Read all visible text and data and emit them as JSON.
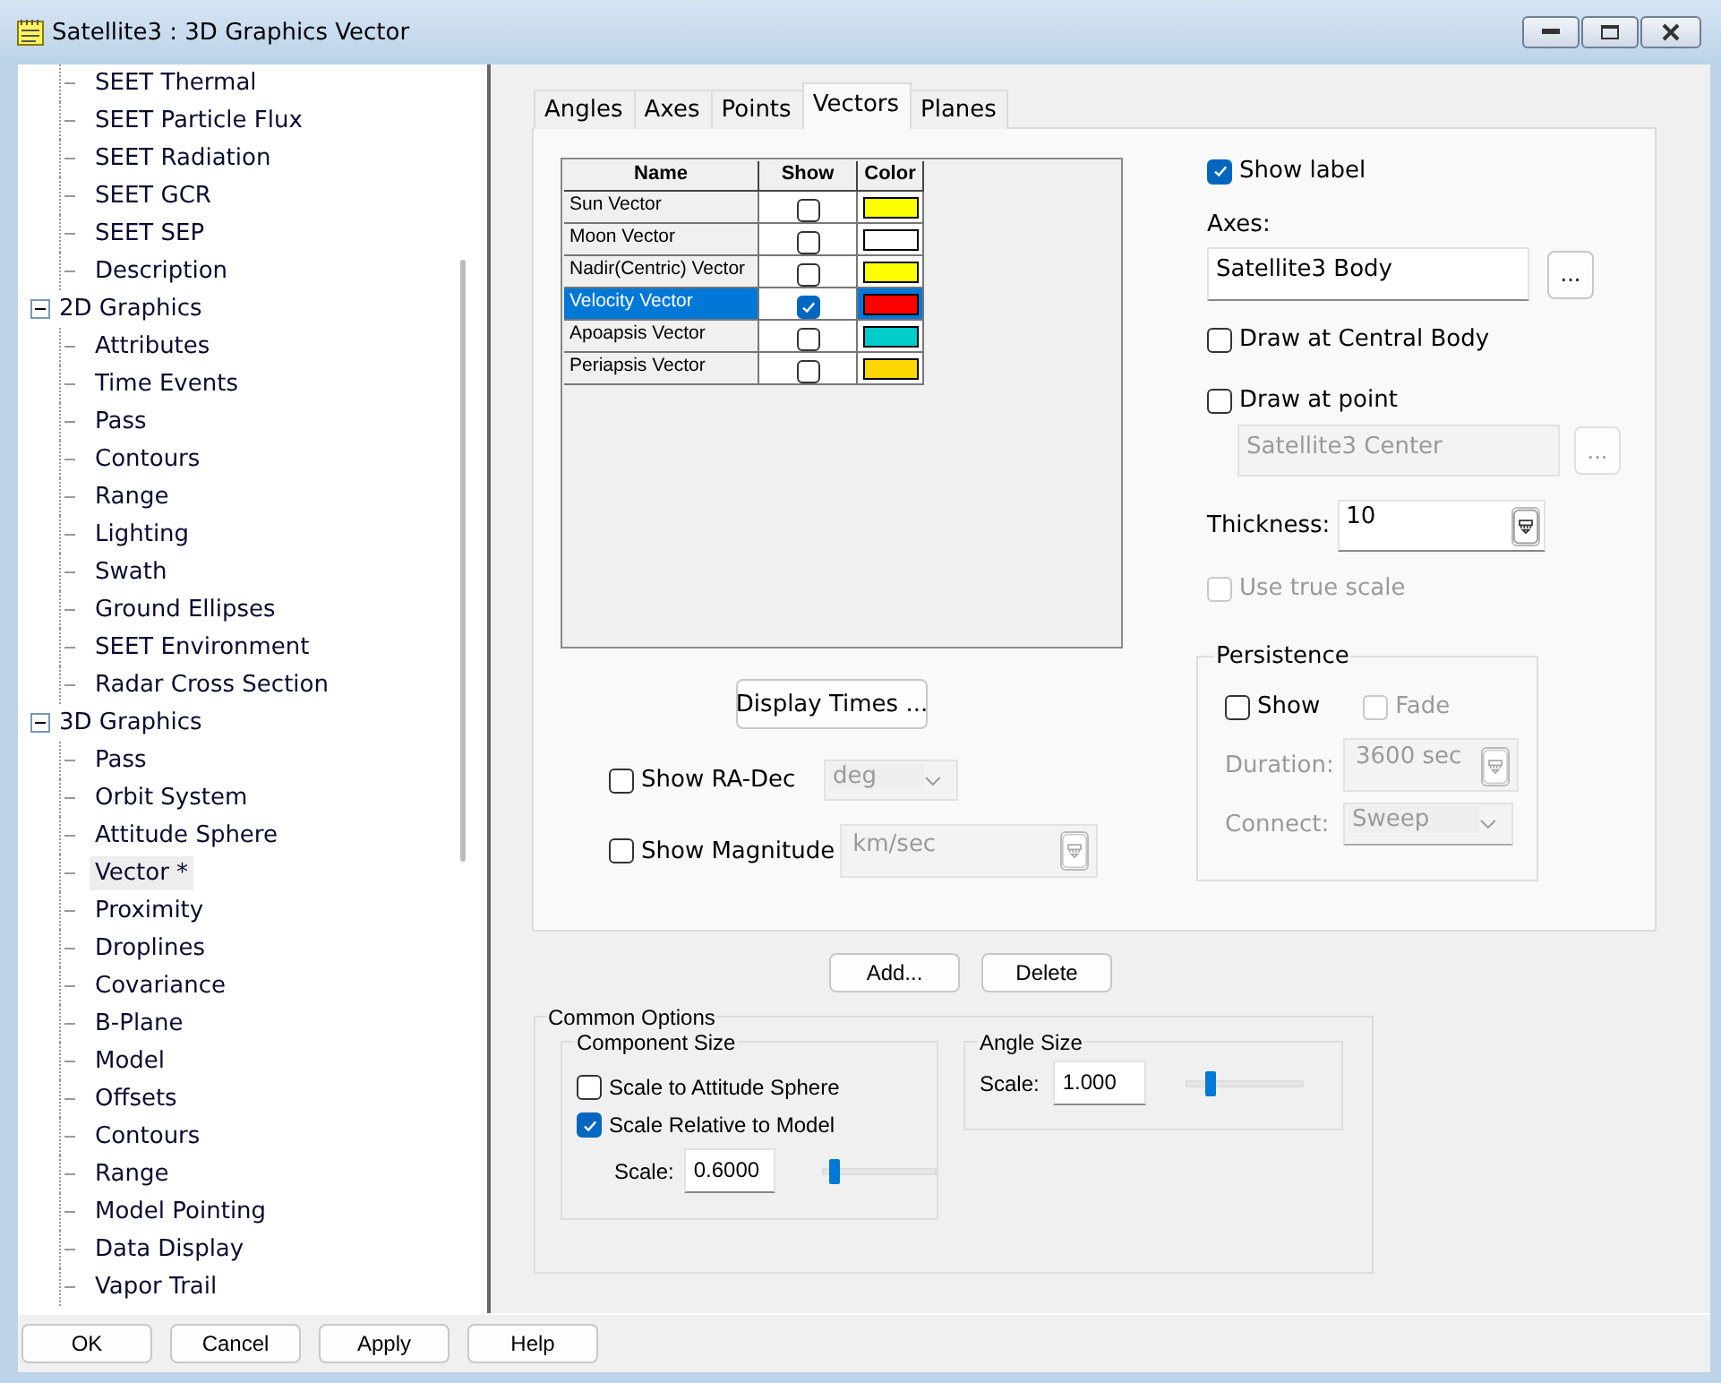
{
  "window": {
    "title": "Satellite3 : 3D Graphics Vector"
  },
  "tree": {
    "items": [
      {
        "label": "SEET Thermal",
        "selected": false
      },
      {
        "label": "SEET Particle Flux",
        "selected": false
      },
      {
        "label": "SEET Radiation",
        "selected": false
      },
      {
        "label": "SEET GCR",
        "selected": false
      },
      {
        "label": "SEET SEP",
        "selected": false
      },
      {
        "label": "Description",
        "selected": false
      },
      {
        "label": "2D Graphics",
        "selected": false,
        "expanded": true,
        "children": [
          {
            "label": "Attributes",
            "selected": false
          },
          {
            "label": "Time Events",
            "selected": false
          },
          {
            "label": "Pass",
            "selected": false
          },
          {
            "label": "Contours",
            "selected": false
          },
          {
            "label": "Range",
            "selected": false
          },
          {
            "label": "Lighting",
            "selected": false
          },
          {
            "label": "Swath",
            "selected": false
          },
          {
            "label": "Ground Ellipses",
            "selected": false
          },
          {
            "label": "SEET Environment",
            "selected": false
          },
          {
            "label": "Radar Cross Section",
            "selected": false
          }
        ]
      },
      {
        "label": "3D Graphics",
        "selected": false,
        "expanded": true,
        "children": [
          {
            "label": "Pass",
            "selected": false
          },
          {
            "label": "Orbit System",
            "selected": false
          },
          {
            "label": "Attitude Sphere",
            "selected": false
          },
          {
            "label": "Vector *",
            "selected": true
          },
          {
            "label": "Proximity",
            "selected": false
          },
          {
            "label": "Droplines",
            "selected": false
          },
          {
            "label": "Covariance",
            "selected": false
          },
          {
            "label": "B-Plane",
            "selected": false
          },
          {
            "label": "Model",
            "selected": false
          },
          {
            "label": "Offsets",
            "selected": false
          },
          {
            "label": "Contours",
            "selected": false
          },
          {
            "label": "Range",
            "selected": false
          },
          {
            "label": "Model Pointing",
            "selected": false
          },
          {
            "label": "Data Display",
            "selected": false
          },
          {
            "label": "Vapor Trail",
            "selected": false
          }
        ]
      }
    ]
  },
  "tabs": [
    {
      "label": "Angles",
      "selected": false
    },
    {
      "label": "Axes",
      "selected": false
    },
    {
      "label": "Points",
      "selected": false
    },
    {
      "label": "Vectors",
      "selected": true
    },
    {
      "label": "Planes",
      "selected": false
    }
  ],
  "vectors": {
    "columns": [
      "Name",
      "Show",
      "Color"
    ],
    "rows": [
      {
        "name": "Sun Vector",
        "show": false,
        "color": "#ffff00",
        "selected": false
      },
      {
        "name": "Moon Vector",
        "show": false,
        "color": "#ffffff",
        "selected": false
      },
      {
        "name": "Nadir(Centric) Vector",
        "show": false,
        "color": "#ffff00",
        "selected": false
      },
      {
        "name": "Velocity Vector",
        "show": true,
        "color": "#ff0000",
        "selected": true
      },
      {
        "name": "Apoapsis Vector",
        "show": false,
        "color": "#00cccc",
        "selected": false
      },
      {
        "name": "Periapsis Vector",
        "show": false,
        "color": "#ffd700",
        "selected": false
      }
    ]
  },
  "display_times_button": "Display Times ...",
  "show_ra_dec": {
    "label": "Show RA-Dec",
    "checked": false,
    "unit": "deg",
    "unit_disabled": true
  },
  "show_magnitude": {
    "label": "Show Magnitude",
    "checked": false,
    "unit": "km/sec",
    "unit_disabled": true
  },
  "show_label": {
    "label": "Show label",
    "checked": true
  },
  "axes": {
    "label": "Axes:",
    "value": "Satellite3 Body",
    "button": "..."
  },
  "draw_at_central_body": {
    "label": "Draw at Central Body",
    "checked": false
  },
  "draw_at_point": {
    "label": "Draw at point",
    "checked": false
  },
  "point": {
    "value": "Satellite3 Center",
    "button": "...",
    "disabled": true
  },
  "thickness": {
    "label": "Thickness:",
    "value": "10"
  },
  "use_true_scale": {
    "label": "Use true scale",
    "checked": false,
    "disabled": true
  },
  "persistence": {
    "title": "Persistence",
    "show": {
      "label": "Show",
      "checked": false
    },
    "fade": {
      "label": "Fade",
      "checked": false,
      "disabled": true
    },
    "duration": {
      "label": "Duration:",
      "value": "3600 sec",
      "disabled": true
    },
    "connect": {
      "label": "Connect:",
      "value": "Sweep",
      "disabled": true
    }
  },
  "list_buttons": [
    "Add...",
    "Delete"
  ],
  "common_options": {
    "title": "Common Options",
    "component_size": {
      "title": "Component Size",
      "scale_to_attitude_sphere": {
        "label": "Scale to Attitude Sphere",
        "checked": false
      },
      "scale_relative_to_model": {
        "label": "Scale Relative to Model",
        "checked": true
      },
      "scale_label": "Scale:",
      "scale": "0.6000",
      "level": 0.1
    },
    "angle_size": {
      "title": "Angle Size",
      "scale_label": "Scale:",
      "scale": "1.000",
      "level": 0.2
    }
  },
  "footer_buttons": [
    "OK",
    "Cancel",
    "Apply",
    "Help"
  ]
}
